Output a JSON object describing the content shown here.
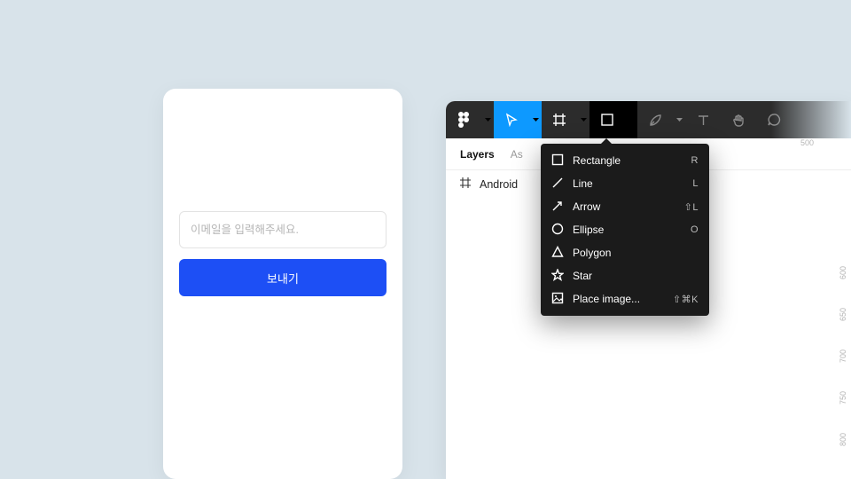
{
  "mobile": {
    "email_placeholder": "이메일을 입력해주세요.",
    "send_label": "보내기"
  },
  "figma": {
    "tabs": {
      "layers": "Layers",
      "assets": "As"
    },
    "layer_name": "Android",
    "ruler_top": [
      "",
      "",
      "500"
    ],
    "ruler_right": [
      "600",
      "650",
      "700",
      "750",
      "800"
    ],
    "shape_menu": [
      {
        "label": "Rectangle",
        "shortcut": "R"
      },
      {
        "label": "Line",
        "shortcut": "L"
      },
      {
        "label": "Arrow",
        "shortcut": "⇧L"
      },
      {
        "label": "Ellipse",
        "shortcut": "O"
      },
      {
        "label": "Polygon",
        "shortcut": ""
      },
      {
        "label": "Star",
        "shortcut": ""
      },
      {
        "label": "Place image...",
        "shortcut": "⇧⌘K"
      }
    ]
  }
}
